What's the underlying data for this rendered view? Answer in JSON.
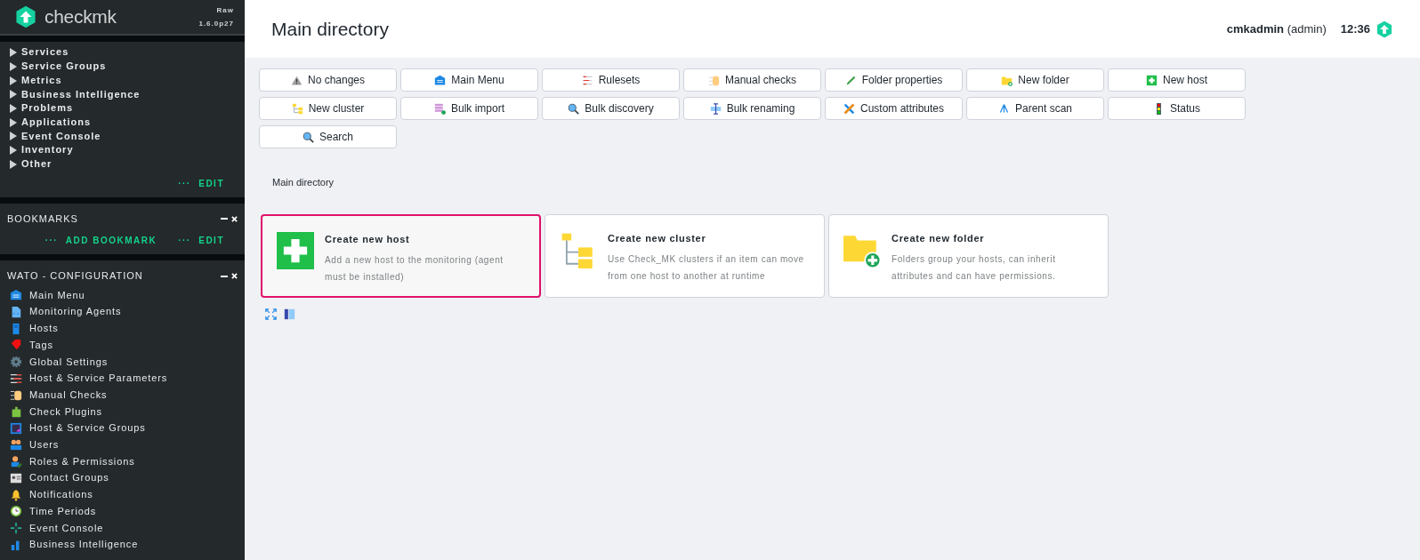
{
  "brand": {
    "logo_text": "checkmk",
    "edition": "Raw",
    "version": "1.6.0p27"
  },
  "views_snapin": {
    "items": [
      {
        "label": "Services",
        "expanded": false
      },
      {
        "label": "Service Groups",
        "expanded": false
      },
      {
        "label": "Metrics",
        "expanded": false
      },
      {
        "label": "Business Intelligence",
        "expanded": false
      },
      {
        "label": "Problems",
        "expanded": false
      },
      {
        "label": "Applications",
        "expanded": false
      },
      {
        "label": "Event Console",
        "expanded": false
      },
      {
        "label": "Inventory",
        "expanded": false
      },
      {
        "label": "Other",
        "expanded": false
      }
    ],
    "links": [
      {
        "dots": "···",
        "label": "EDIT"
      }
    ]
  },
  "bookmarks_snapin": {
    "title": "BOOKMARKS",
    "links": [
      {
        "dots": "···",
        "label": "ADD BOOKMARK"
      },
      {
        "dots": "···",
        "label": "EDIT"
      }
    ]
  },
  "wato_snapin": {
    "title": "WATO - CONFIGURATION",
    "items": [
      "Main Menu",
      "Monitoring Agents",
      "Hosts",
      "Tags",
      "Global Settings",
      "Host & Service Parameters",
      "Manual Checks",
      "Check Plugins",
      "Host & Service Groups",
      "Users",
      "Roles & Permissions",
      "Contact Groups",
      "Notifications",
      "Time Periods",
      "Event Console",
      "Business Intelligence"
    ]
  },
  "header": {
    "title": "Main directory",
    "user": "cmkadmin",
    "role": "(admin)",
    "time": "12:36"
  },
  "buttons": [
    "No changes",
    "Main Menu",
    "Rulesets",
    "Manual checks",
    "Folder properties",
    "New folder",
    "New host",
    "New cluster",
    "Bulk import",
    "Bulk discovery",
    "Bulk renaming",
    "Custom attributes",
    "Parent scan",
    "Status",
    "Search"
  ],
  "breadcrumb": "Main directory",
  "cards": [
    {
      "title": "Create new host",
      "description": "Add a new host to the monitoring (agent must be installed)",
      "selected": true
    },
    {
      "title": "Create new cluster",
      "description": "Use Check_MK clusters if an item can move from one host to another at runtime",
      "selected": false
    },
    {
      "title": "Create new folder",
      "description": "Folders group your hosts, can inherit attributes and can have permissions.",
      "selected": false
    }
  ]
}
